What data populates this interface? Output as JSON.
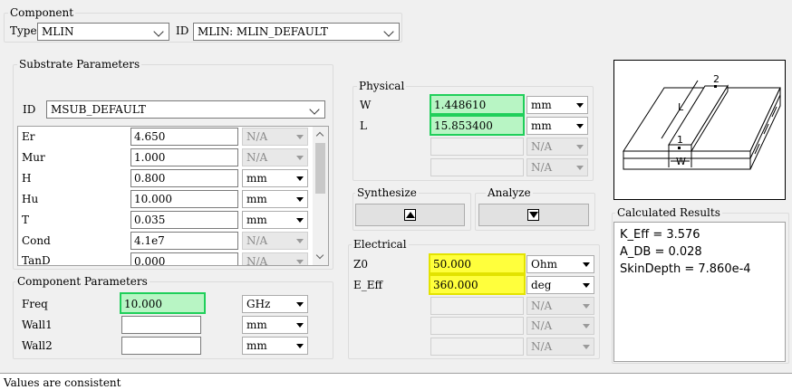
{
  "component": {
    "group_title": "Component",
    "type_label": "Type",
    "type_value": "MLIN",
    "id_label": "ID",
    "id_value": "MLIN: MLIN_DEFAULT"
  },
  "substrate": {
    "group_title": "Substrate Parameters",
    "id_label": "ID",
    "id_value": "MSUB_DEFAULT",
    "params": [
      {
        "name": "Er",
        "value": "4.650",
        "unit": "N/A",
        "unit_enabled": false
      },
      {
        "name": "Mur",
        "value": "1.000",
        "unit": "N/A",
        "unit_enabled": false
      },
      {
        "name": "H",
        "value": "0.800",
        "unit": "mm",
        "unit_enabled": true
      },
      {
        "name": "Hu",
        "value": "10.000",
        "unit": "mm",
        "unit_enabled": true
      },
      {
        "name": "T",
        "value": "0.035",
        "unit": "mm",
        "unit_enabled": true
      },
      {
        "name": "Cond",
        "value": "4.1e7",
        "unit": "N/A",
        "unit_enabled": false
      },
      {
        "name": "TanD",
        "value": "0.000",
        "unit": "N/A",
        "unit_enabled": false
      }
    ]
  },
  "component_params": {
    "group_title": "Component Parameters",
    "rows": [
      {
        "name": "Freq",
        "value": "10.000",
        "unit": "GHz"
      },
      {
        "name": "Wall1",
        "value": "",
        "unit": "mm"
      },
      {
        "name": "Wall2",
        "value": "",
        "unit": "mm"
      }
    ]
  },
  "physical": {
    "group_title": "Physical",
    "rows": [
      {
        "name": "W",
        "value": "1.448610",
        "unit": "mm"
      },
      {
        "name": "L",
        "value": "15.853400",
        "unit": "mm"
      },
      {
        "name": "",
        "value": "",
        "unit": "N/A"
      },
      {
        "name": "",
        "value": "",
        "unit": "N/A"
      }
    ]
  },
  "synthesize": {
    "label": "Synthesize"
  },
  "analyze": {
    "label": "Analyze"
  },
  "electrical": {
    "group_title": "Electrical",
    "rows": [
      {
        "name": "Z0",
        "value": "50.000",
        "unit": "Ohm"
      },
      {
        "name": "E_Eff",
        "value": "360.000",
        "unit": "deg"
      },
      {
        "name": "",
        "value": "",
        "unit": "N/A"
      },
      {
        "name": "",
        "value": "",
        "unit": "N/A"
      },
      {
        "name": "",
        "value": "",
        "unit": "N/A"
      }
    ]
  },
  "diagram": {
    "label_1": "1",
    "label_2": "2",
    "label_l": "L",
    "label_w": "W"
  },
  "calculated_results": {
    "group_title": "Calculated Results",
    "lines": [
      "K_Eff = 3.576",
      "A_DB = 0.028",
      "SkinDepth = 7.860e-4"
    ]
  },
  "status_bar": {
    "text": "Values are consistent"
  },
  "colors": {
    "highlight_green": "#b8f5c4",
    "highlight_yellow": "#ffff3c",
    "panel_bg": "#f0f0f0"
  }
}
